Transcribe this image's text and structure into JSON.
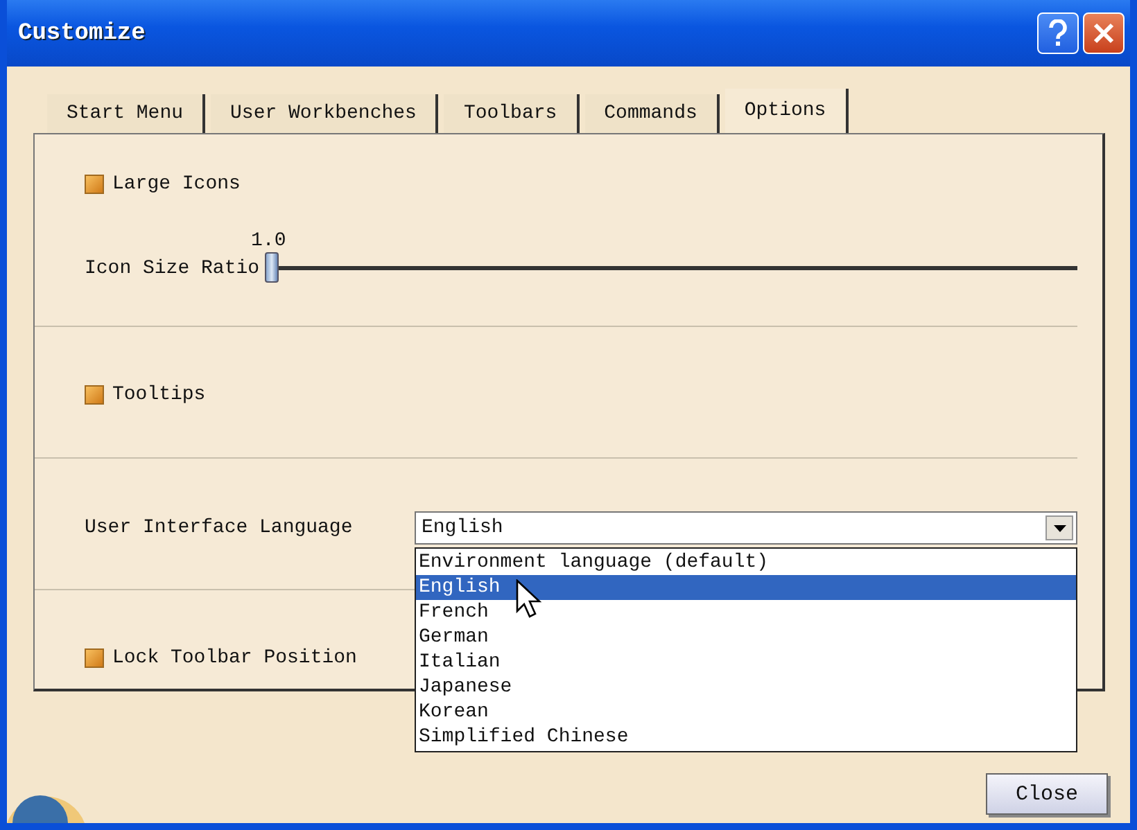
{
  "window": {
    "title": "Customize"
  },
  "tabs": [
    {
      "label": "Start Menu",
      "selected": false
    },
    {
      "label": "User Workbenches",
      "selected": false
    },
    {
      "label": "Toolbars",
      "selected": false
    },
    {
      "label": "Commands",
      "selected": false
    },
    {
      "label": "Options",
      "selected": true
    }
  ],
  "sections": [
    {
      "kind": "checkbox",
      "label": "Large Icons",
      "checked": true,
      "slider": {
        "label": "Icon Size Ratio",
        "reading": "1.0",
        "level": 0
      }
    },
    {
      "kind": "checkbox",
      "label": "Tooltips",
      "checked": true
    },
    {
      "kind": "dropdown",
      "label": "User Interface Language",
      "value": "English",
      "expanded": true,
      "options": [
        {
          "label": "Environment language (default)",
          "selected": false
        },
        {
          "label": "English",
          "selected": true
        },
        {
          "label": "French",
          "selected": false
        },
        {
          "label": "German",
          "selected": false
        },
        {
          "label": "Italian",
          "selected": false
        },
        {
          "label": "Japanese",
          "selected": false
        },
        {
          "label": "Korean",
          "selected": false
        },
        {
          "label": "Simplified Chinese",
          "selected": false
        }
      ]
    },
    {
      "kind": "checkbox",
      "label": "Lock Toolbar Position",
      "checked": true
    }
  ],
  "buttons": [
    {
      "label": "Close"
    }
  ]
}
